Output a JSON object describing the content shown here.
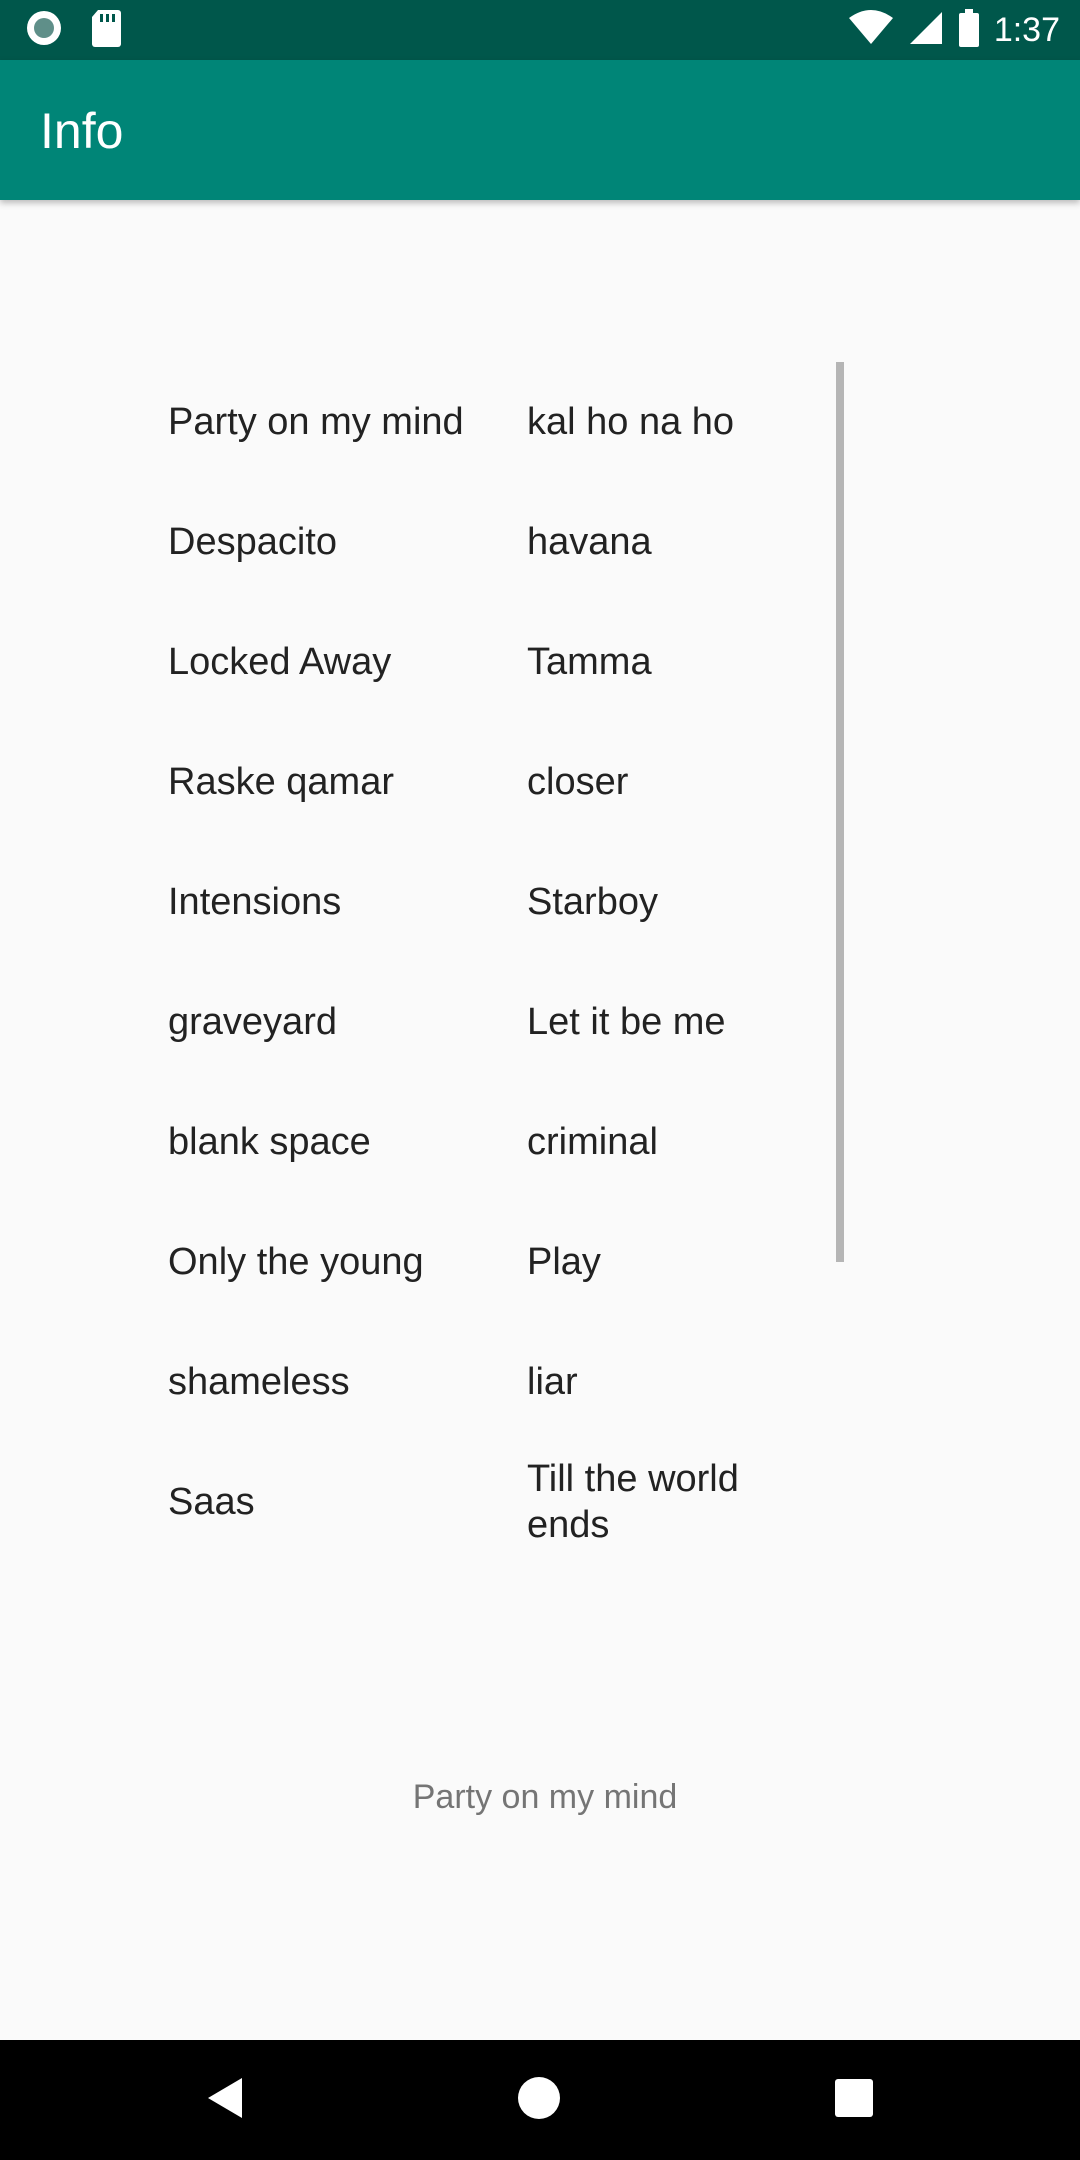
{
  "status_bar": {
    "time": "1:37",
    "left_icons": [
      "notification-dot-icon",
      "sd-card-icon"
    ],
    "right_icons": [
      "wifi-icon",
      "cell-signal-icon",
      "battery-icon"
    ]
  },
  "app_bar": {
    "title": "Info"
  },
  "songs": {
    "items": [
      "Party on my mind",
      "kal ho na ho",
      "Despacito",
      "havana",
      "Locked Away",
      "Tamma",
      "Raske qamar",
      "closer",
      "Intensions",
      "Starboy",
      "graveyard",
      "Let it be me",
      "blank space",
      "criminal",
      "Only the young",
      "Play",
      "shameless",
      "liar",
      "Saas",
      "Till the world ends"
    ]
  },
  "selected": {
    "text": "Party on my mind"
  },
  "nav_bar": {
    "buttons": [
      "back-icon",
      "home-icon",
      "recents-icon"
    ]
  },
  "colors": {
    "status_bar": "#00574b",
    "app_bar": "#008577",
    "background": "#fafafa"
  }
}
